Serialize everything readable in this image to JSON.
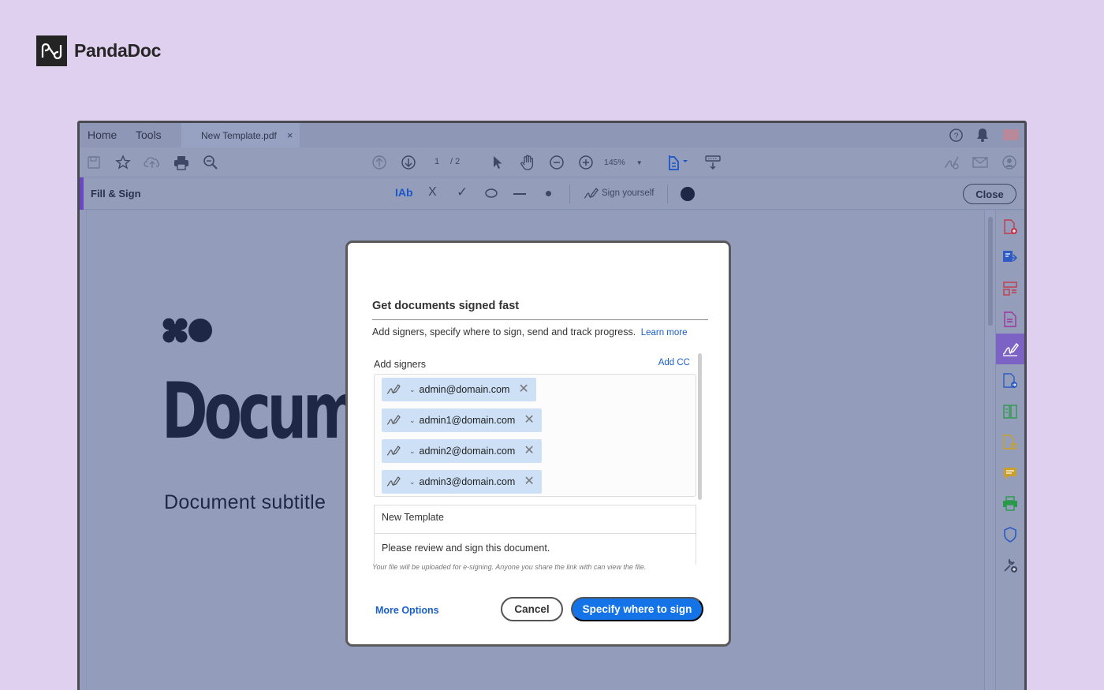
{
  "brand": {
    "name": "PandaDoc",
    "logo_icon": "pandadoc-logo"
  },
  "app": {
    "menu": [
      "Home",
      "Tools"
    ],
    "tab": {
      "label": "New Template.pdf",
      "close": "×"
    },
    "toolbar": {
      "page_current": "1",
      "page_total": "/ 2",
      "zoom": "145%",
      "icons": [
        "save-icon",
        "star-icon",
        "upload-cloud-icon",
        "print-icon",
        "search-zoom-icon",
        "page-up-icon",
        "page-down-icon",
        "pointer-icon",
        "hand-icon",
        "zoom-out-icon",
        "zoom-in-icon",
        "fit-page-icon",
        "scroll-mode-icon",
        "sign-link-icon",
        "email-icon",
        "share-user-icon"
      ]
    },
    "fill_sign": {
      "label": "Fill & Sign",
      "text_tool": "IAb",
      "cross": "X",
      "check": "✓",
      "sign_yourself": "Sign yourself",
      "close": "Close",
      "dot_color": "#1e2746"
    },
    "right_panel_icons": [
      "create-pdf-icon",
      "export-pdf-icon",
      "organize-pages-icon",
      "edit-pdf-icon",
      "fill-sign-icon",
      "send-review-icon",
      "compare-icon",
      "combine-icon",
      "comment-icon",
      "print-production-icon",
      "protect-icon",
      "more-tools-icon"
    ],
    "accent_color": "#6b47c4"
  },
  "document": {
    "title": "Docum",
    "subtitle": "Document subtitle"
  },
  "modal": {
    "title": "Get documents signed fast",
    "description": "Add signers, specify where to sign, send and track progress.",
    "learn_more": "Learn more",
    "add_signers": "Add signers",
    "add_cc": "Add CC",
    "signers": [
      {
        "email": "admin@domain.com"
      },
      {
        "email": "admin1@domain.com"
      },
      {
        "email": "admin2@domain.com"
      },
      {
        "email": "admin3@domain.com"
      }
    ],
    "doc_name": "New Template",
    "message": "Please review and sign this document.",
    "note": "Your file will be uploaded for e-signing. Anyone you share the link with can view the file.",
    "more_options": "More Options",
    "cancel": "Cancel",
    "primary": "Specify where to sign",
    "primary_color": "#1473e6"
  }
}
